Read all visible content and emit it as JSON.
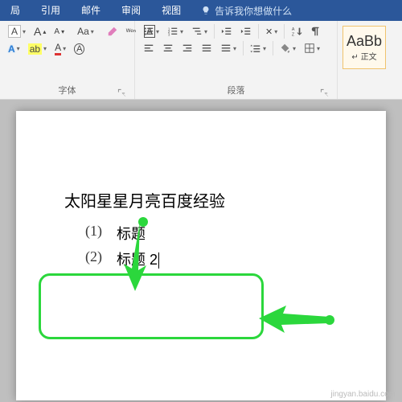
{
  "tabs": {
    "t1": "局",
    "t2": "引用",
    "t3": "邮件",
    "t4": "审阅",
    "t5": "视图"
  },
  "tell_me": "告诉我你想做什么",
  "font_group": {
    "label": "字体",
    "btn_size_placeholder": "A",
    "btn_grow": "A",
    "btn_shrink": "A",
    "btn_aa": "Aa",
    "btn_clear": "✎",
    "btn_phonetic": "ᵂᵉⁿ",
    "btn_border": "A",
    "btn_highlight": "ab",
    "btn_fontcolor": "A"
  },
  "para_group": {
    "label": "段落"
  },
  "styles_group": {
    "label": "正文",
    "sample": "AaBb"
  },
  "doc": {
    "title": "太阳星星月亮百度经验",
    "items": [
      {
        "prefix": "(1)",
        "text": "标题"
      },
      {
        "prefix": "(2)",
        "text": "标题 2"
      }
    ]
  },
  "watermark": "jingyan.baidu.com"
}
